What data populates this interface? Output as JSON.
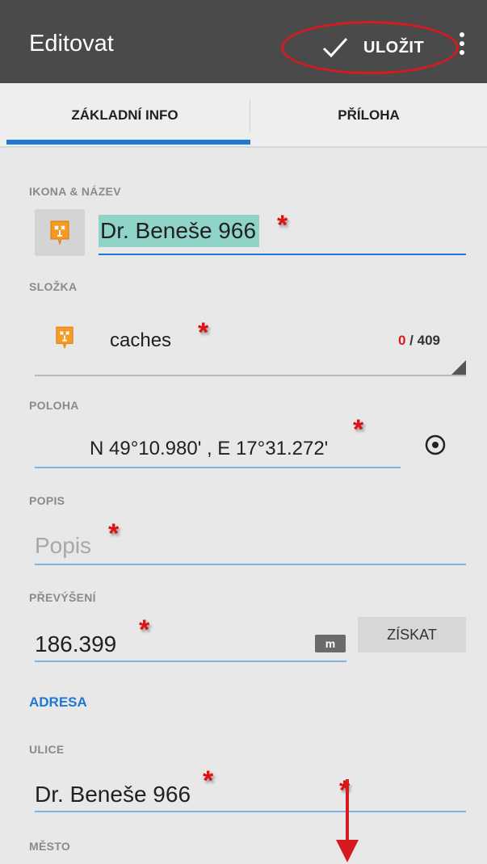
{
  "app_bar": {
    "title": "Editovat",
    "save_label": "ULOŽIT",
    "check_icon": "check-icon",
    "more_icon": "more-vert-icon"
  },
  "tabs": [
    {
      "label": "ZÁKLADNÍ INFO",
      "active": true
    },
    {
      "label": "PŘÍLOHA",
      "active": false
    }
  ],
  "sections": {
    "icon_name": {
      "label": "IKONA & NÁZEV",
      "value": "Dr. Beneše 966",
      "icon": "geocache-icon"
    },
    "folder": {
      "label": "SLOŽKA",
      "value": "caches",
      "count_used": "0",
      "count_total": " / 409",
      "icon": "geocache-icon"
    },
    "location": {
      "label": "POLOHA",
      "value": "N 49°10.980' , E 17°31.272'",
      "icon": "gps-target-icon"
    },
    "description": {
      "label": "POPIS",
      "placeholder": "Popis"
    },
    "elevation": {
      "label": "PŘEVÝŠENÍ",
      "value": "186.399",
      "unit": "m",
      "button": "ZÍSKAT"
    },
    "address": {
      "header": "ADRESA"
    },
    "street": {
      "label": "ULICE",
      "value": "Dr. Beneše 966"
    },
    "city": {
      "label": "MĚSTO"
    }
  },
  "annotations": {
    "star": "*",
    "accent": "#d71920"
  }
}
